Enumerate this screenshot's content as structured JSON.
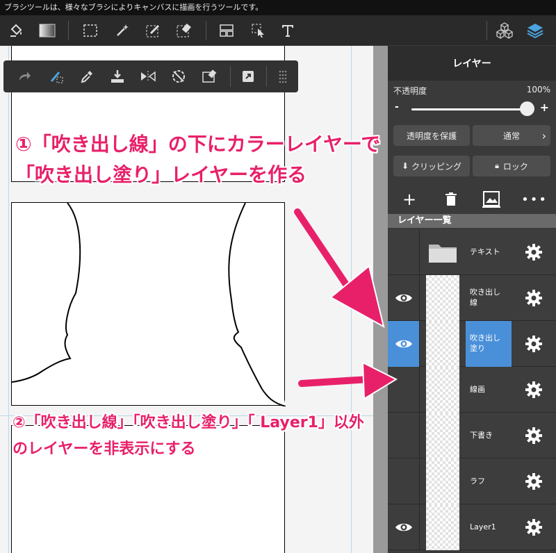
{
  "status_text": "ブラシツールは、様々なブラシによりキャンバスに描画を行うツールです。",
  "top_toolbar": {
    "tools": [
      "fill-bucket-icon",
      "gradient-icon",
      "rect-select-icon",
      "magic-wand-icon",
      "select-pen-icon",
      "select-eraser-icon",
      "frame-icon",
      "move-select-icon",
      "text-icon",
      "cubes-icon",
      "layers-icon"
    ]
  },
  "float_toolbar": {
    "tools": [
      "redo-icon",
      "transform-icon",
      "eyedropper-icon",
      "import-icon",
      "flip-icon",
      "rotate-icon",
      "erase-select-icon",
      "expand-icon",
      "grid-dots-icon"
    ]
  },
  "layer_panel": {
    "title": "レイヤー",
    "opacity_label": "不透明度",
    "opacity_value": "100%",
    "opacity_fraction": 1.0,
    "slider_minus": "-",
    "slider_plus": "+",
    "protect_alpha_label": "透明度を保護",
    "blend_mode_label": "通常",
    "clipping_label": "クリッピング",
    "lock_label": "ロック",
    "list_header": "レイヤー一覧",
    "layers": [
      {
        "name": "テキスト",
        "visible": false,
        "selected": false,
        "folder": true
      },
      {
        "name": "吹き出し\n線",
        "visible": true,
        "selected": false,
        "folder": false
      },
      {
        "name": "吹き出し\n塗り",
        "visible": true,
        "selected": true,
        "folder": false
      },
      {
        "name": "線画",
        "visible": false,
        "selected": false,
        "folder": false
      },
      {
        "name": "下書き",
        "visible": false,
        "selected": false,
        "folder": false
      },
      {
        "name": "ラフ",
        "visible": false,
        "selected": false,
        "folder": false
      },
      {
        "name": "Layer1",
        "visible": true,
        "selected": false,
        "folder": false
      }
    ]
  },
  "annotations": {
    "step1": "①「吹き出し線」の下にカラーレイヤーで「吹き出し塗り」レイヤーを作る",
    "step2": "②「吹き出し線」「吹き出し塗り」「 Layer1」以外のレイヤーを非表示にする"
  },
  "colors": {
    "accent": "#e8206a",
    "selected_layer": "#4a90d9",
    "layers_icon": "#4aa3df"
  }
}
